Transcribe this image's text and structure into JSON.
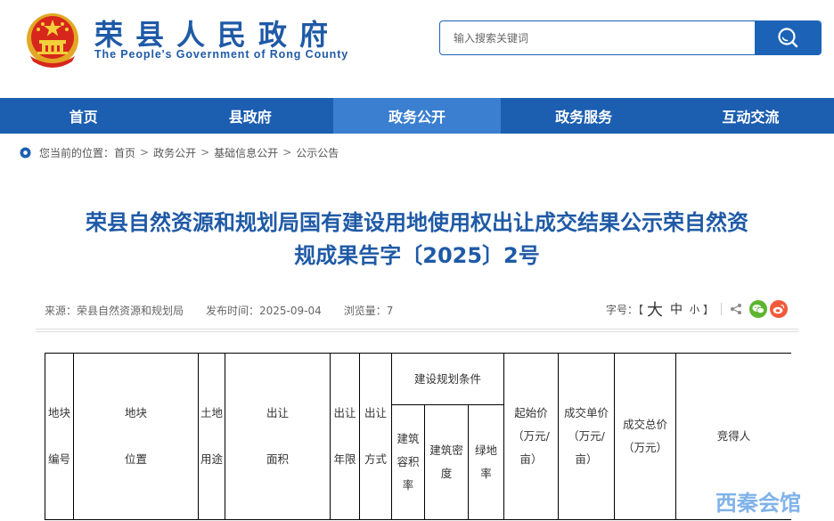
{
  "header": {
    "title_cn": "荣县人民政府",
    "title_en": "The People's Government of Rong County",
    "emblem_icon": "national-emblem-icon"
  },
  "search": {
    "placeholder": "输入搜索关键词",
    "button_icon": "search-icon"
  },
  "nav": {
    "items": [
      {
        "label": "首页",
        "active": false
      },
      {
        "label": "县政府",
        "active": false
      },
      {
        "label": "政务公开",
        "active": true
      },
      {
        "label": "政务服务",
        "active": false
      },
      {
        "label": "互动交流",
        "active": false
      }
    ]
  },
  "breadcrumb": {
    "prefix": "您当前的位置：",
    "items": [
      "首页",
      "政务公开",
      "基础信息公开",
      "公示公告"
    ],
    "separator": ">"
  },
  "article": {
    "title_line1": "荣县自然资源和规划局国有建设用地使用权出让成交结果公示荣自然资",
    "title_line2": "规成果告字〔2025〕2号",
    "source": "来源：荣县自然资源和规划局",
    "publish_time": "发布时间：2025-09-04",
    "views": "浏览量：7",
    "font_size_label": "字号：【",
    "font_size_big": "大",
    "font_size_mid": "中",
    "font_size_small": "小",
    "font_size_close": "】"
  },
  "table": {
    "col_plot_no": [
      "地块",
      "编号"
    ],
    "col_location": [
      "地块",
      "位置"
    ],
    "col_land_use": [
      "土地",
      "用途"
    ],
    "col_area": [
      "出让",
      "面积"
    ],
    "col_term": [
      "出让",
      "年限"
    ],
    "col_method": [
      "出让",
      "方式"
    ],
    "col_planning": "建设规划条件",
    "sub_far": [
      "建筑",
      "容积",
      "率"
    ],
    "sub_density": [
      "建筑密",
      "度"
    ],
    "sub_green": "绿地率",
    "col_start_price": [
      "起始价",
      "（万元/",
      "亩）"
    ],
    "col_unit_price": [
      "成交单价",
      "（万元/",
      "亩）"
    ],
    "col_total_price": [
      "成交总价",
      "（万元）"
    ],
    "col_winner": "竞得人"
  },
  "watermark": "西秦会馆",
  "colors": {
    "brand_blue": "#1f5aa6",
    "nav_blue": "#1c5eb0",
    "nav_active": "#3a7fd0"
  }
}
